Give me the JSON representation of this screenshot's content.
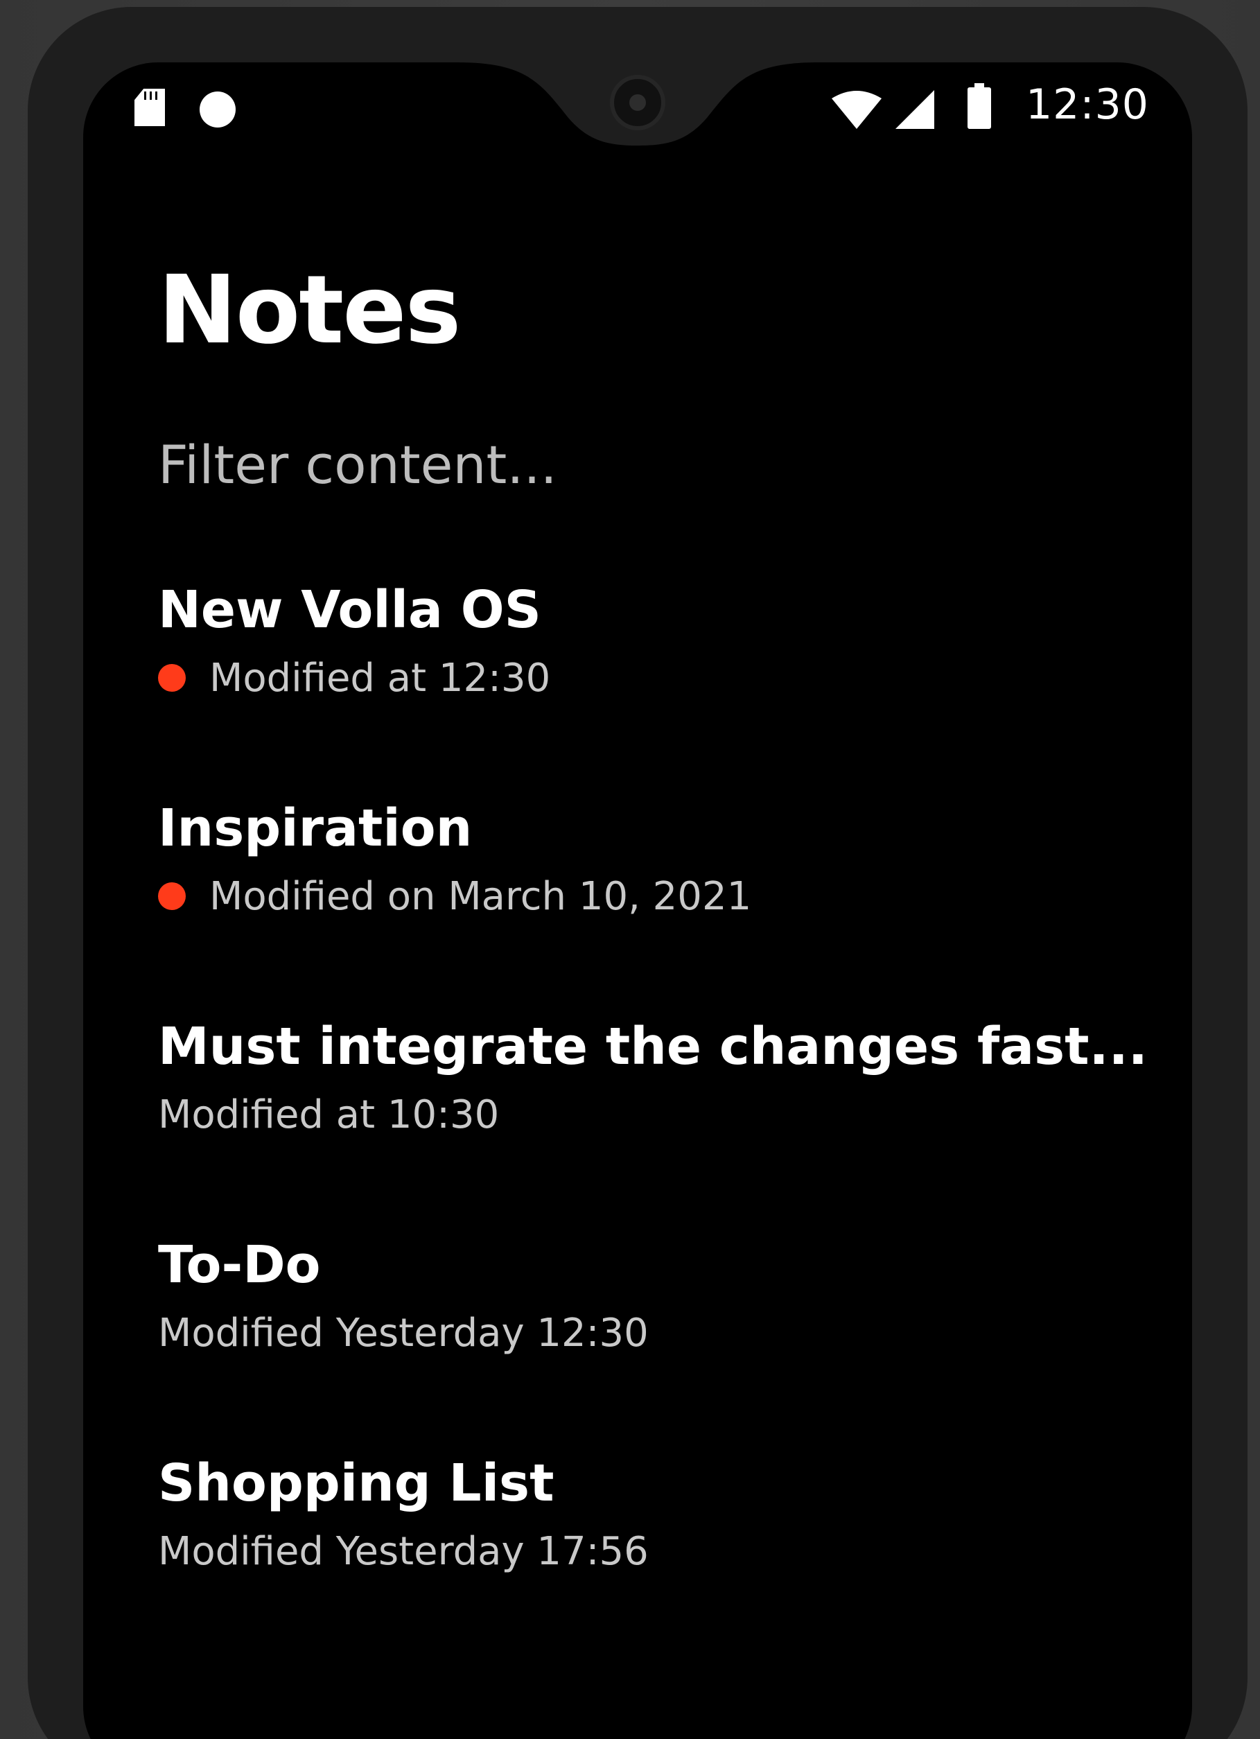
{
  "status_bar": {
    "time": "12:30",
    "left_icons": [
      "sd-card-icon",
      "notification-dot-icon"
    ],
    "right_icons": [
      "wifi-icon",
      "cellular-signal-icon",
      "battery-icon"
    ]
  },
  "header": {
    "title": "Notes"
  },
  "search": {
    "placeholder": "Filter content..."
  },
  "notes": [
    {
      "title": "New Volla OS",
      "modified": "Modified at 12:30",
      "unread": true
    },
    {
      "title": "Inspiration",
      "modified": "Modified on March 10, 2021",
      "unread": true
    },
    {
      "title": "Must integrate the changes fast...",
      "modified": "Modified at 10:30",
      "unread": false
    },
    {
      "title": "To-Do",
      "modified": "Modified Yesterday 12:30",
      "unread": false
    },
    {
      "title": "Shopping List",
      "modified": "Modified Yesterday 17:56",
      "unread": false
    }
  ],
  "colors": {
    "background": "#000000",
    "text_primary": "#ffffff",
    "text_secondary": "#c9c9c9",
    "unread_indicator": "#ff3b1a"
  }
}
